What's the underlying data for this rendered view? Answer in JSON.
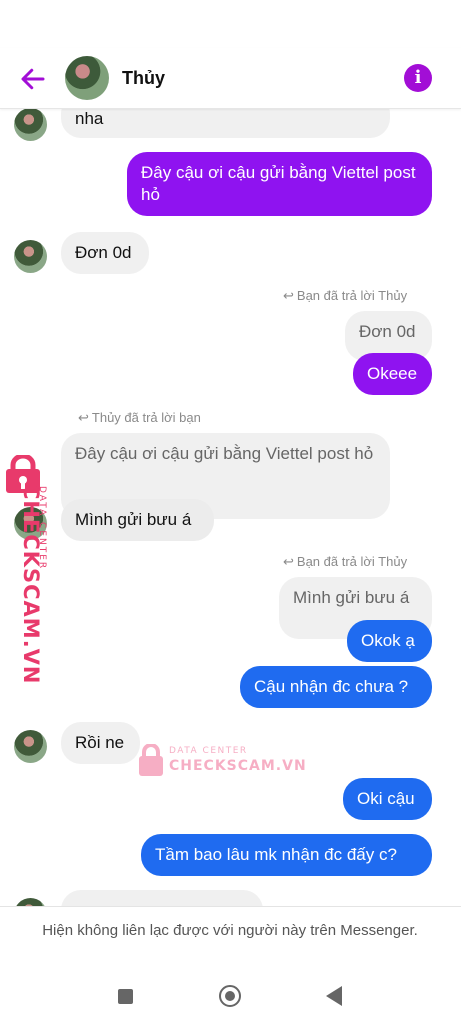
{
  "header": {
    "contact_name": "Thủy",
    "back_icon": "arrow-left-icon",
    "info_icon": "info-icon",
    "accent": "#a20ed6"
  },
  "messages": [
    {
      "id": "m1",
      "from": "them",
      "text": "nha"
    },
    {
      "id": "m2",
      "from": "me",
      "text": "Đây cậu ơi cậu gửi bằng Viettel post hỏ"
    },
    {
      "id": "m3",
      "from": "them",
      "text": "Đơn 0d"
    },
    {
      "id": "m4",
      "from": "me",
      "reply_note": "Bạn đã trả lời Thủy",
      "quoted": "Đơn 0d",
      "text": "Okeee"
    },
    {
      "id": "m5",
      "from": "them",
      "reply_note": "Thủy đã trả lời bạn",
      "quoted": "Đây cậu ơi cậu gửi bằng Viettel post hỏ",
      "text": "Mình gửi bưu á"
    },
    {
      "id": "m6",
      "from": "me",
      "reply_note": "Bạn đã trả lời Thủy",
      "quoted": "Mình gửi bưu á",
      "text": "Okok ạ"
    },
    {
      "id": "m7",
      "from": "me",
      "text": "Cậu nhận đc chưa ?"
    },
    {
      "id": "m8",
      "from": "them",
      "text": "Rồi ne"
    },
    {
      "id": "m9",
      "from": "me",
      "text": "Oki cậu"
    },
    {
      "id": "m10",
      "from": "me",
      "text": "Tầm bao lâu mk nhận đc đấy c?"
    }
  ],
  "colors": {
    "my_purple": "#8f13f0",
    "my_blue": "#1f6bf0",
    "their_bubble": "#f0f0f0"
  },
  "footer": {
    "notice": "Hiện không liên lạc được với người này trên Messenger."
  },
  "watermark": {
    "small": "DATA CENTER",
    "big": "CHECKSCAM.VN",
    "icon": "lock-icon"
  },
  "navbar": {
    "recent_icon": "square-icon",
    "home_icon": "circle-icon",
    "back_icon": "triangle-back-icon"
  }
}
